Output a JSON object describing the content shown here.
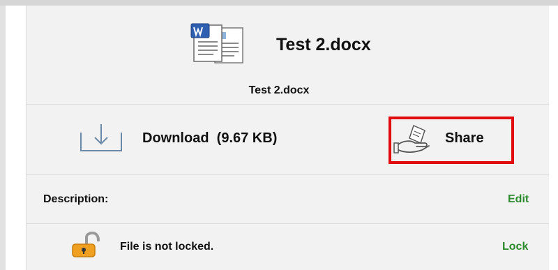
{
  "file": {
    "title": "Test 2.docx",
    "name": "Test 2.docx",
    "icon": "word-document-icon"
  },
  "actions": {
    "download_label": "Download  (9.67 KB)",
    "download_icon": "download-icon",
    "share_label": "Share",
    "share_icon": "share-hand-icon",
    "highlight_color": "#e10b0b"
  },
  "description": {
    "label": "Description:",
    "edit_label": "Edit"
  },
  "lock": {
    "status": "File is not locked.",
    "lock_label": "Lock",
    "icon": "unlocked-padlock-icon"
  },
  "colors": {
    "link": "#2b8a2b",
    "panel_bg": "#f2f2f2"
  }
}
